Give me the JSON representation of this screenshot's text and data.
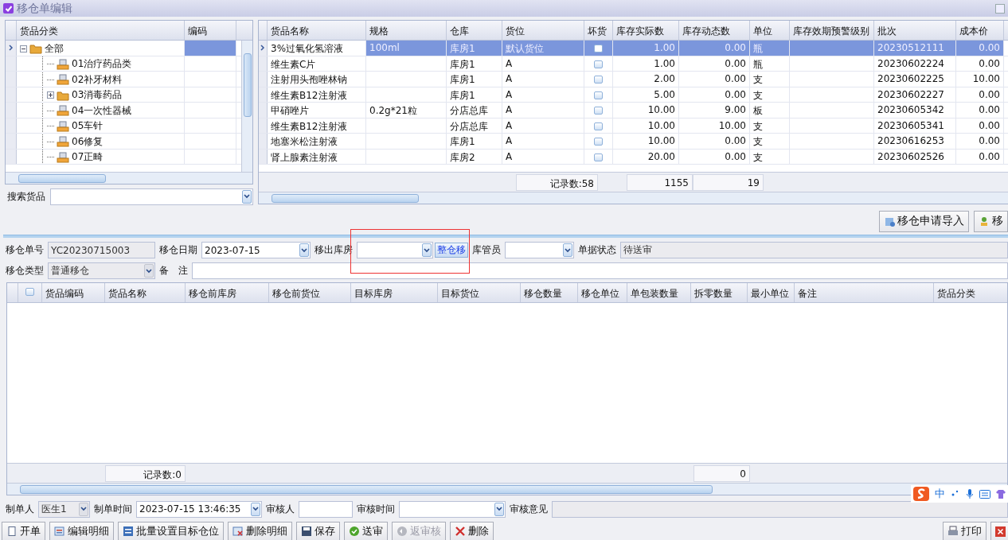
{
  "window": {
    "title": "移仓单编辑"
  },
  "category_tree": {
    "columns": [
      "货品分类",
      "编码"
    ],
    "items": [
      {
        "label": "全部",
        "kind": "folder",
        "expanded": true,
        "selected": true,
        "children": [
          {
            "label": "01治疗药品类",
            "kind": "item",
            "selected": false
          },
          {
            "label": "02补牙材料",
            "kind": "item",
            "selected": false
          },
          {
            "label": "03消毒药品",
            "kind": "folder",
            "expanded": false,
            "selected": false
          },
          {
            "label": "04一次性器械",
            "kind": "item",
            "selected": false
          },
          {
            "label": "05车针",
            "kind": "item",
            "selected": false
          },
          {
            "label": "06修复",
            "kind": "item",
            "selected": false
          },
          {
            "label": "07正畸",
            "kind": "item",
            "selected": false
          }
        ]
      }
    ]
  },
  "search": {
    "label": "搜索货品"
  },
  "stock_table": {
    "columns": [
      "货品名称",
      "规格",
      "仓库",
      "货位",
      "坏货",
      "库存实际数",
      "库存动态数",
      "单位",
      "库存效期预警级别",
      "批次",
      "成本价"
    ],
    "rows": [
      {
        "selected": true,
        "damaged": false,
        "cells": [
          "3%过氧化氢溶液",
          "100ml",
          "库房1",
          "默认货位",
          "",
          "1.00",
          "0.00",
          "瓶",
          "",
          "20230512111",
          "0.00"
        ]
      },
      {
        "selected": false,
        "damaged": false,
        "cells": [
          "维生素C片",
          "",
          "库房1",
          "A",
          "",
          "1.00",
          "0.00",
          "瓶",
          "",
          "20230602224",
          "0.00"
        ]
      },
      {
        "selected": false,
        "damaged": false,
        "cells": [
          "注射用头孢唑林钠",
          "",
          "库房1",
          "A",
          "",
          "2.00",
          "0.00",
          "支",
          "",
          "20230602225",
          "10.00"
        ]
      },
      {
        "selected": false,
        "damaged": false,
        "cells": [
          "维生素B12注射液",
          "",
          "库房1",
          "A",
          "",
          "5.00",
          "0.00",
          "支",
          "",
          "20230602227",
          "0.00"
        ]
      },
      {
        "selected": false,
        "damaged": false,
        "cells": [
          "甲硝唑片",
          "0.2g*21粒",
          "分店总库",
          "A",
          "",
          "10.00",
          "9.00",
          "板",
          "",
          "20230605342",
          "0.00"
        ]
      },
      {
        "selected": false,
        "damaged": false,
        "cells": [
          "维生素B12注射液",
          "",
          "分店总库",
          "A",
          "",
          "10.00",
          "10.00",
          "支",
          "",
          "20230605341",
          "0.00"
        ]
      },
      {
        "selected": false,
        "damaged": false,
        "cells": [
          "地塞米松注射液",
          "",
          "库房1",
          "A",
          "",
          "10.00",
          "0.00",
          "支",
          "",
          "20230616253",
          "0.00"
        ]
      },
      {
        "selected": false,
        "damaged": false,
        "cells": [
          "肾上腺素注射液",
          "",
          "库房2",
          "A",
          "",
          "20.00",
          "0.00",
          "支",
          "",
          "20230602526",
          "0.00"
        ]
      }
    ],
    "footer": {
      "count": "记录数:58",
      "actual_total": "1155",
      "dynamic_total": "19"
    }
  },
  "toolbar": [
    "移仓申请导入",
    "移"
  ],
  "form": {
    "order_no": {
      "label": "移仓单号",
      "value": "YC20230715003",
      "readonly": true
    },
    "date": {
      "label": "移仓日期",
      "value": "2023-07-15"
    },
    "source_room": {
      "label": "移出库房",
      "button": "整仓移"
    },
    "keeper": {
      "label": "库管员"
    },
    "status": {
      "label": "单据状态",
      "value": "待送审",
      "readonly": true
    },
    "type": {
      "label": "移仓类型",
      "value": "普通移仓",
      "readonly": true
    },
    "remark": {
      "label": "备　注"
    }
  },
  "detail_table": {
    "all_checked": false,
    "columns": [
      "货品编码",
      "货品名称",
      "移仓前库房",
      "移仓前货位",
      "目标库房",
      "目标货位",
      "移仓数量",
      "移仓单位",
      "单包装数量",
      "拆零数量",
      "最小单位",
      "备注",
      "货品分类"
    ],
    "footer": {
      "count": "记录数:0",
      "split_total": "0"
    }
  },
  "audit": {
    "creator": {
      "label": "制单人",
      "value": "医生1",
      "readonly": true
    },
    "created": {
      "label": "制单时间",
      "value": "2023-07-15 13:46:35"
    },
    "auditor": {
      "label": "审核人"
    },
    "audit_time": {
      "label": "审核时间"
    },
    "opinion": {
      "label": "审核意见"
    }
  },
  "ime": {
    "mode": "中"
  },
  "actions": [
    {
      "label": "开单",
      "disabled": false
    },
    {
      "label": "编辑明细",
      "disabled": false
    },
    {
      "label": "批量设置目标仓位",
      "disabled": false
    },
    {
      "label": "删除明细",
      "disabled": false
    },
    {
      "label": "保存",
      "disabled": false
    },
    {
      "label": "送审",
      "disabled": false
    },
    {
      "label": "返审核",
      "disabled": true
    },
    {
      "label": "删除",
      "disabled": false
    }
  ],
  "right_actions": [
    {
      "label": "打印",
      "disabled": false
    }
  ]
}
